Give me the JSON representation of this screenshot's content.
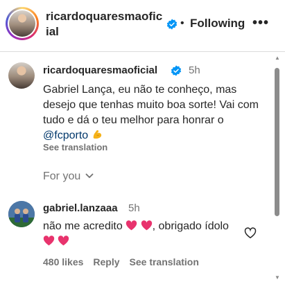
{
  "header": {
    "username": "ricardoquaresmaoficial",
    "separator": "•",
    "follow_state": "Following",
    "more_label": "•••"
  },
  "caption": {
    "username": "ricardoquaresmaoficial",
    "time": "5h",
    "text_before_mention": "Gabriel Lança, eu não te conheço, mas desejo que tenhas muito boa sorte! Vai com tudo e dá o teu melhor para honrar o ",
    "mention": "@fcporto",
    "emoji_icon": "flexed-biceps",
    "see_translation": "See translation"
  },
  "for_you": {
    "label": "For you"
  },
  "reply": {
    "username": "gabriel.lanzaaa",
    "time": "5h",
    "text_part1": "não me acredito",
    "text_part2": ", obrigado ídolo",
    "emoji_icon": "pink-heart",
    "likes": "480 likes",
    "reply_label": "Reply",
    "see_translation": "See translation"
  },
  "colors": {
    "verified_blue": "#0095f6",
    "mention_blue": "#00376b",
    "secondary_text": "#737373",
    "heart_pink": "#e8336d"
  }
}
